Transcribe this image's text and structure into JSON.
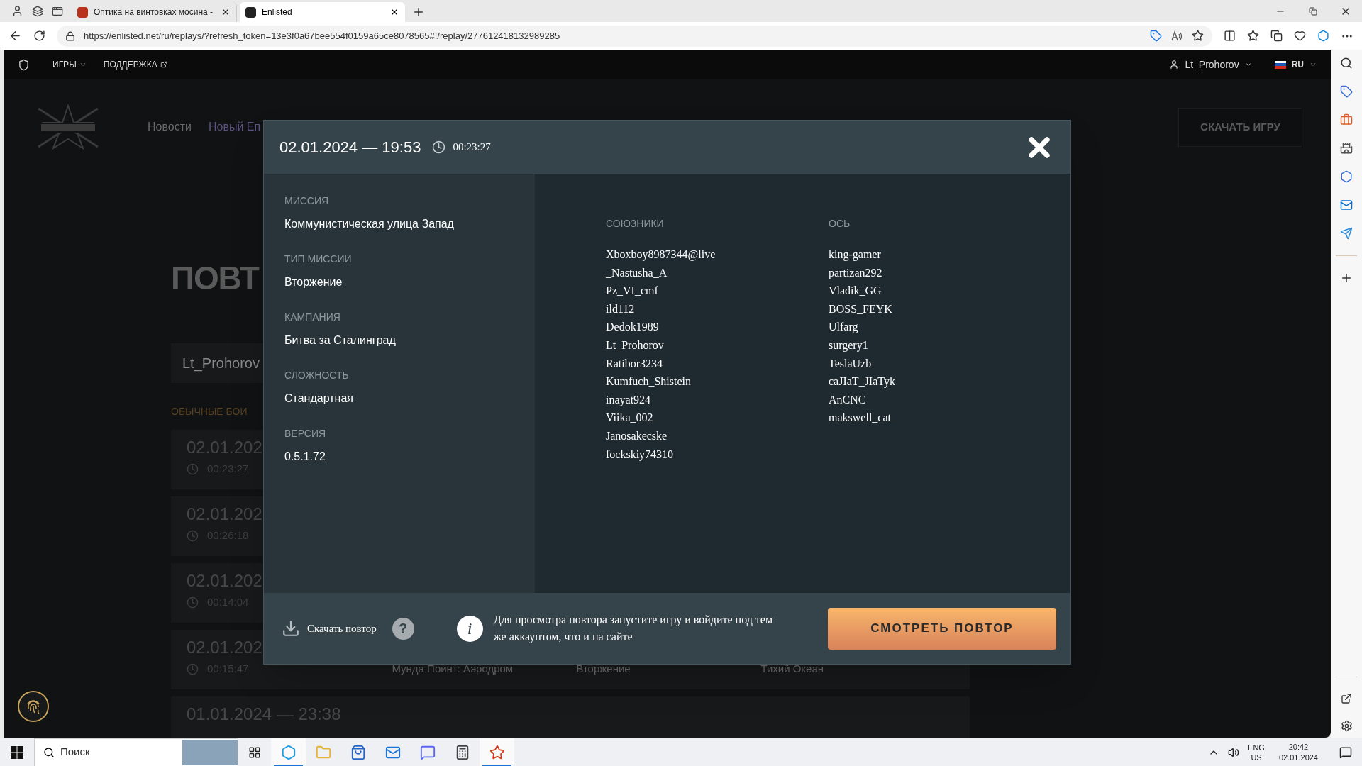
{
  "browser": {
    "tabs": [
      {
        "title": "Оптика на винтовках мосина -",
        "selected": false
      },
      {
        "title": "Enlisted",
        "selected": true
      }
    ],
    "url": "https://enlisted.net/ru/replays/?refresh_token=13e3f0a67bee554f0159a65ce8078565#!/replay/277612418132989285"
  },
  "site_nav": {
    "items": [
      "ИГРЫ",
      "ПОДДЕРЖКА"
    ],
    "user": "Lt_Prohorov",
    "language": "RU"
  },
  "page": {
    "nav_links": [
      "Новости",
      "Новый Еп"
    ],
    "download_button": "СКАЧАТЬ ИГРУ",
    "heading": "ПОВТ",
    "search": {
      "value": "Lt_Prohorov"
    },
    "section": "ОБЫЧНЫЕ БОИ",
    "replays": [
      {
        "date": "02.01.202",
        "duration": "00:23:27"
      },
      {
        "date": "02.01.202",
        "duration": "00:26:18"
      },
      {
        "date": "02.01.202",
        "duration": "00:14:04"
      },
      {
        "date": "02.01.202",
        "duration": "00:15:47",
        "values": [
          "Мунда Поинт: Аэродром",
          "Вторжение",
          "Тихий Океан"
        ]
      },
      {
        "date": "01.01.2024 — 23:38"
      }
    ]
  },
  "modal": {
    "date": "02.01.2024 — 19:53",
    "duration": "00:23:27",
    "details": [
      {
        "label": "МИССИЯ",
        "value": "Коммунистическая улица Запад"
      },
      {
        "label": "ТИП МИССИИ",
        "value": "Вторжение"
      },
      {
        "label": "КАМПАНИЯ",
        "value": "Битва за Сталинград"
      },
      {
        "label": "СЛОЖНОСТЬ",
        "value": "Стандартная"
      },
      {
        "label": "ВЕРСИЯ",
        "value": "0.5.1.72"
      }
    ],
    "teams": [
      {
        "title": "СОЮЗНИКИ",
        "players": [
          "Xboxboy8987344@live",
          "_Nastusha_A",
          "Pz_VI_cmf",
          "ild112",
          "Dedok1989",
          "Lt_Prohorov",
          "Ratibor3234",
          "Kumfuch_Shistein",
          "inayat924",
          "Viika_002",
          "Janosakecske",
          "fockskiy74310"
        ]
      },
      {
        "title": "ОСЬ",
        "players": [
          "king-gamer",
          "partizan292",
          "Vladik_GG",
          "BOSS_FEYK",
          "Ulfarg",
          "surgery1",
          "TeslaUzb",
          "caJIaT_JIaTyk",
          "AnCNC",
          "makswell_cat"
        ]
      }
    ],
    "download_link": "Скачать повтор",
    "help": "?",
    "info": "i",
    "notice": "Для просмотра повтора запустите игру и войдите под тем же аккаунтом, что и на сайте",
    "watch_button": "СМОТРЕТЬ ПОВТОР"
  },
  "taskbar": {
    "search_placeholder": "Поиск",
    "apps": [
      {
        "kind": "edge",
        "running": true
      },
      {
        "kind": "explorer",
        "running": false
      },
      {
        "kind": "store",
        "running": false
      },
      {
        "kind": "mail",
        "running": false
      },
      {
        "kind": "discord",
        "running": false
      },
      {
        "kind": "calculator",
        "running": false
      },
      {
        "kind": "game",
        "running": true
      }
    ],
    "language": [
      "ENG",
      "US"
    ],
    "time": "20:42",
    "date": "02.01.2024"
  }
}
